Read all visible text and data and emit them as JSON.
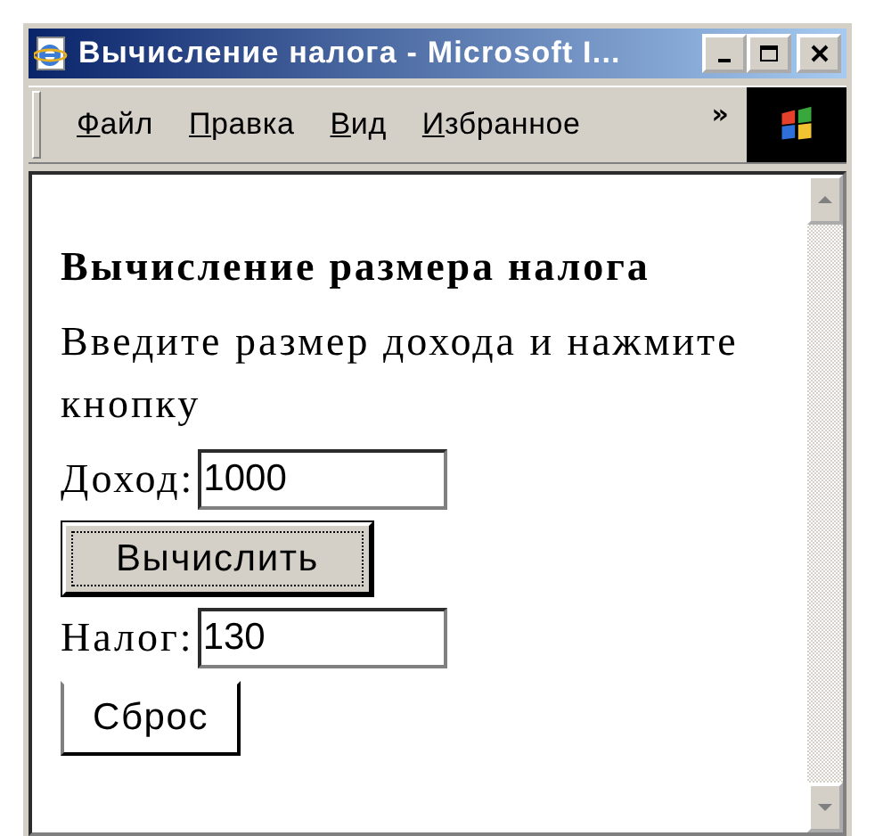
{
  "window": {
    "title": "Вычисление налога - Microsoft I..."
  },
  "menu": {
    "items": [
      {
        "mnemonic": "Ф",
        "rest": "айл"
      },
      {
        "mnemonic": "П",
        "rest": "равка"
      },
      {
        "mnemonic": "В",
        "rest": "ид"
      },
      {
        "mnemonic": "И",
        "rest": "збранное"
      }
    ],
    "overflow": "»"
  },
  "page": {
    "heading": "Вычисление размера налога",
    "intro": "Введите размер дохода и нажмите кнопку",
    "form": [
      {
        "kind": "field",
        "label": "Доход:",
        "value": "1000"
      },
      {
        "kind": "button",
        "label": "Вычислить",
        "default": true
      },
      {
        "kind": "field",
        "label": "Налог:",
        "value": "130"
      },
      {
        "kind": "button",
        "label": "Сброс",
        "default": false
      }
    ]
  }
}
